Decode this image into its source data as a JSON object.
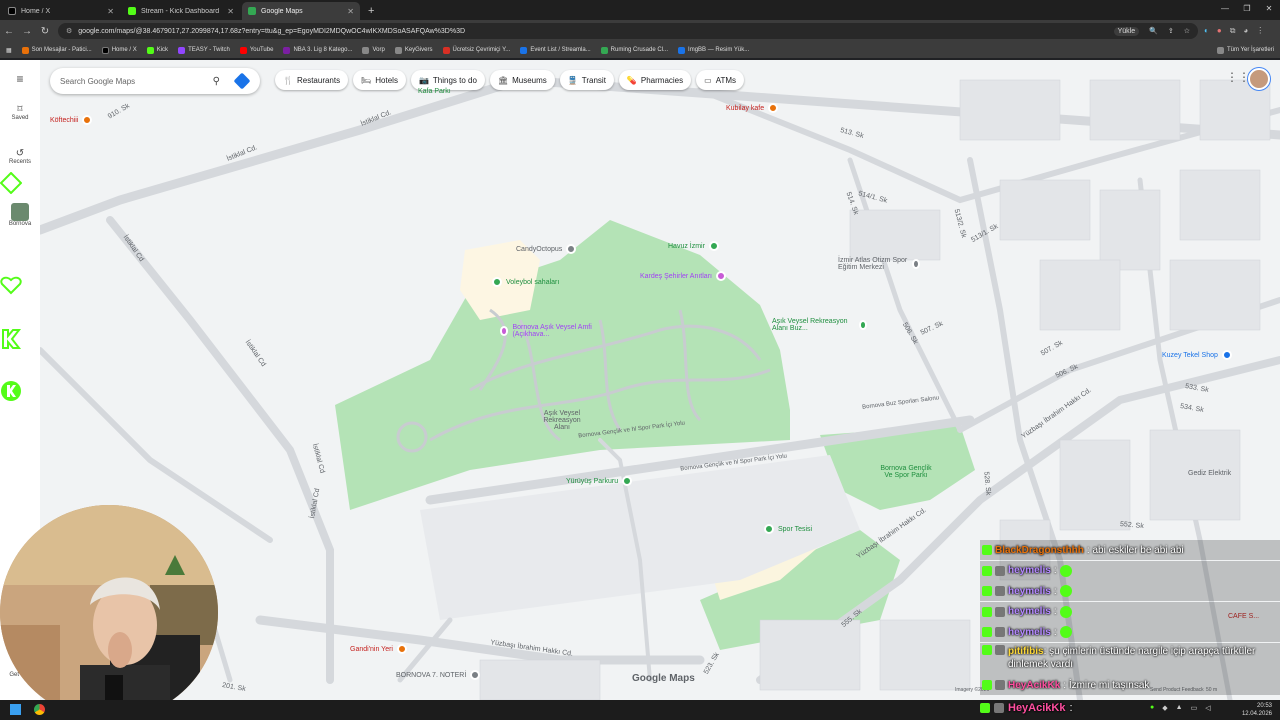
{
  "browser": {
    "tabs": [
      {
        "label": "Home / X",
        "fav_color": "#000000",
        "active": false
      },
      {
        "label": "Stream - Kick Dashboard",
        "fav_color": "#53fc18",
        "active": false
      },
      {
        "label": "Google Maps",
        "fav_color": "#34a853",
        "active": true
      }
    ],
    "new_tab": "+",
    "url": "google.com/maps/@38.4679017,27.2099874,17.68z?entry=ttu&g_ep=EgoyMDI2MDQwOC4wIKXMDSoASAFQAw%3D%3D",
    "translate_label": "Yükle",
    "bookmarks": [
      {
        "label": "Son Mesajlar - Patici...",
        "color": "#e8710a"
      },
      {
        "label": "Home / X",
        "color": "#000000"
      },
      {
        "label": "Kick",
        "color": "#53fc18"
      },
      {
        "label": "TEASY - Twitch",
        "color": "#9146ff"
      },
      {
        "label": "YouTube",
        "color": "#ff0000"
      },
      {
        "label": "NBA 3. Lig 8 Katego...",
        "color": "#7b1fa2"
      },
      {
        "label": "Vorp",
        "color": "#888888"
      },
      {
        "label": "KeyGivers",
        "color": "#888888"
      },
      {
        "label": "Ücretsiz Çevrimiçi Y...",
        "color": "#d93025"
      },
      {
        "label": "Event List / Streamla...",
        "color": "#1a73e8"
      },
      {
        "label": "Ruming Crusade Cl...",
        "color": "#34a853"
      },
      {
        "label": "ImgBB — Resim Yük...",
        "color": "#1a73e8"
      }
    ],
    "bookmarks_all": "Tüm Yer İşaretleri"
  },
  "maps": {
    "search_placeholder": "Search Google Maps",
    "rail": {
      "saved": "Saved",
      "recents": "Recents",
      "bottom": "Bornova",
      "get_app": "Get app"
    },
    "chips": [
      {
        "label": "Restaurants",
        "icon": "fork-knife-icon"
      },
      {
        "label": "Hotels",
        "icon": "bed-icon"
      },
      {
        "label": "Things to do",
        "icon": "camera-icon"
      },
      {
        "label": "Museums",
        "icon": "museum-icon"
      },
      {
        "label": "Transit",
        "icon": "train-icon"
      },
      {
        "label": "Pharmacies",
        "icon": "pharmacy-icon"
      },
      {
        "label": "ATMs",
        "icon": "atm-icon"
      }
    ],
    "streets": {
      "istiklal_cd": "İstiklal Cd.",
      "istiklal_cd_2": "İstiklal Cd",
      "s910": "910. Sk",
      "s513": "513. Sk",
      "s514": "514. Sk",
      "s5141": "514/1. Sk",
      "s5132": "513/2. Sk",
      "s5131": "513/1. Sk",
      "s507": "507. Sk",
      "s506": "506. Sk",
      "s533": "533. Sk",
      "s534": "534. Sk",
      "s528": "528. Sk",
      "s552": "552. Sk",
      "s555": "555. Sk",
      "s523": "523. Sk",
      "s201": "201. Sk",
      "yuzbasi": "Yüzbaşı İbrahim Hakkı Cd.",
      "genclik": "Bornova Gençlik ve hl Spor Park İçi Yolu",
      "genclik2": "Bornova Gençlik ve hl Spor Park İçi Yolu",
      "sporlar": "Bornova Buz Sporları Salonu"
    },
    "places": {
      "koftecioglu": "Köftechiii",
      "kafa_parki": "Kafa Parkı",
      "kubilay": "Kubilay kafe",
      "candy": "CandyOctopus",
      "havuz": "Havuz İzmir",
      "kardes": "Kardeş Şehirler Anıtları",
      "voleybol": "Voleybol sahaları",
      "amfi": "Bornova Aşık Veysel Amfi (Açıkhava...",
      "atlas": "İzmir Atlas Otizm Spor Eğitim Merkezi",
      "rekreasyon_buz": "Aşık Veysel Rekreasyon Alanı Buz...",
      "rekreasyon": "Aşık Veysel Rekreasyon Alanı",
      "kuzey": "Kuzey Tekel Shop",
      "yuruyus": "Yürüyüş Parkuru",
      "genclik_park": "Bornova Gençlik Ve Spor Parkı",
      "spor": "Spor Tesisi",
      "gediz": "Gediz Elektrik",
      "gandiin": "Gandi'nin Yeri",
      "noter": "BORNOVA 7. NOTERİ",
      "cafe": "CAFE S..."
    },
    "logo": "Google Maps",
    "imagery": "Imagery ©2026",
    "feedback": "Send Product Feedback",
    "scale": "50 m"
  },
  "chat": {
    "messages": [
      {
        "user": "BlackDragonsthhh",
        "color": "#e8710a",
        "text": ": abi eskiler be abi abi",
        "emote": false
      },
      {
        "user": "heymelis",
        "color": "#b388ff",
        "text": ":",
        "emote": true
      },
      {
        "user": "heymelis",
        "color": "#b388ff",
        "text": ":",
        "emote": true
      },
      {
        "user": "heymelis",
        "color": "#b388ff",
        "text": ":",
        "emote": true
      },
      {
        "user": "heymelis",
        "color": "#b388ff",
        "text": ":",
        "emote": true
      },
      {
        "user": "pitifibis",
        "color": "#fdd835",
        "text": ": şu çimlerin üstünde nargile içip arapça türküler dinlemek vardı",
        "emote": false
      },
      {
        "user": "HeyAcikKk",
        "color": "#ff4fa0",
        "text": ": İzmire mi taşınsak",
        "emote": false
      }
    ],
    "bottom_user": "HeyAcikKk",
    "bottom_text": ":"
  },
  "taskbar": {
    "time": "20:53",
    "date": "12.04.2026"
  },
  "colors": {
    "park": "#b4e3b6",
    "road": "#d5d8dc",
    "water": "#aadaff",
    "brand": "#53fc18"
  }
}
